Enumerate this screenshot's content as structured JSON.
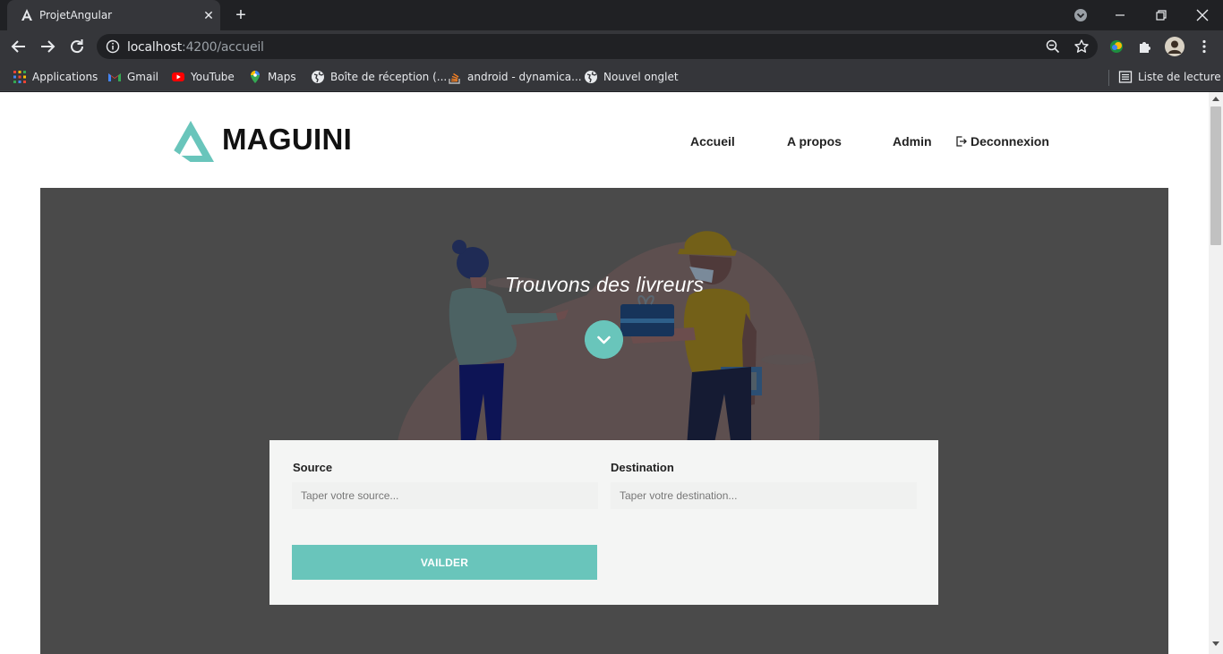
{
  "browser": {
    "tab_title": "ProjetAngular",
    "url_host": "localhost",
    "url_rest": ":4200/accueil",
    "bookmarks": [
      {
        "label": "Applications",
        "icon": "apps-grid-icon"
      },
      {
        "label": "Gmail",
        "icon": "gmail-icon"
      },
      {
        "label": "YouTube",
        "icon": "youtube-icon"
      },
      {
        "label": "Maps",
        "icon": "maps-icon"
      },
      {
        "label": "Boîte de réception (...",
        "icon": "globe-icon"
      },
      {
        "label": "android - dynamica...",
        "icon": "stackoverflow-icon"
      },
      {
        "label": "Nouvel onglet",
        "icon": "globe-icon"
      }
    ],
    "reading_list": "Liste de lecture"
  },
  "page": {
    "brand": "MAGUINI",
    "nav": {
      "home": "Accueil",
      "about": "A propos",
      "admin": "Admin",
      "logout": "Deconnexion"
    },
    "hero": {
      "title": "Trouvons des livreurs"
    },
    "form": {
      "source_label": "Source",
      "source_placeholder": "Taper votre source...",
      "destination_label": "Destination",
      "destination_placeholder": "Taper votre destination...",
      "submit_label": "VAILDER"
    }
  },
  "colors": {
    "accent": "#69c5bb",
    "hero_bg": "#4a4a4a",
    "card_bg": "#f4f5f4"
  }
}
